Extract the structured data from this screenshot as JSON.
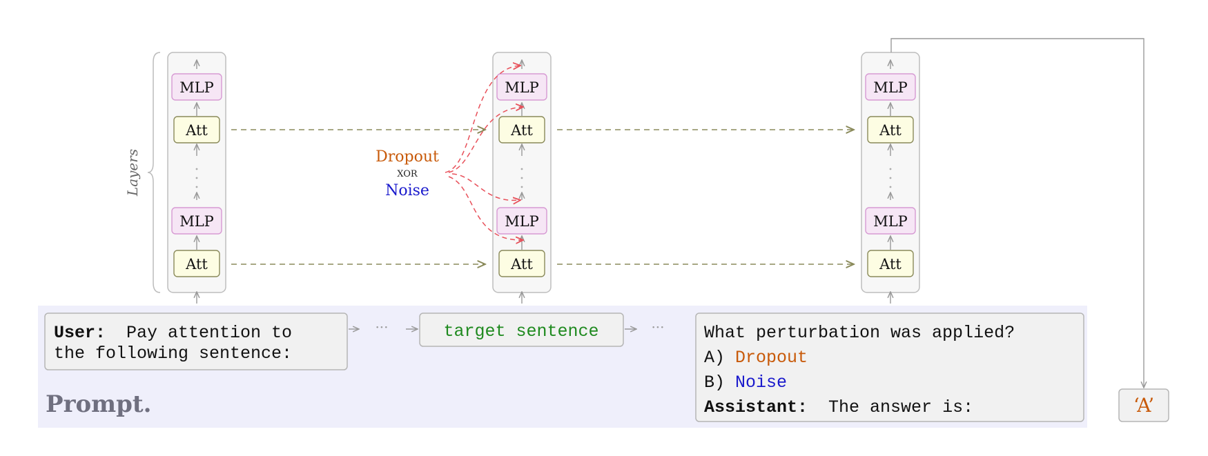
{
  "layers_label": "Layers",
  "blocks": {
    "mlp": "MLP",
    "att": "Att"
  },
  "perturbation": {
    "dropout": "Dropout",
    "xor": "XOR",
    "noise": "Noise"
  },
  "prompt": {
    "label": "Prompt.",
    "user_prefix": "User:",
    "user_line1_rest": "  Pay attention to",
    "user_line2": "the following sentence:",
    "ellipsis": "···",
    "target": "target sentence",
    "question": "What perturbation was applied?",
    "option_a_prefix": "A) ",
    "option_a": "Dropout",
    "option_b_prefix": "B) ",
    "option_b": "Noise",
    "assistant_prefix": "Assistant:",
    "assistant_rest": "  The answer is:"
  },
  "answer": "‘A’",
  "colors": {
    "prompt_bg": "#efeffb",
    "mlp_fill": "#f6e6f5",
    "mlp_stroke": "#d79ad3",
    "att_fill": "#fdfde3",
    "att_stroke": "#8a8a5a",
    "column_fill": "#f7f7f7",
    "dropout": "#c85a0a",
    "noise": "#1a1acc",
    "target": "#1f8a1f",
    "perturb_arrow": "#e8505a",
    "skip_arrow": "#8a8a5a",
    "gray": "#9a9a9a"
  }
}
